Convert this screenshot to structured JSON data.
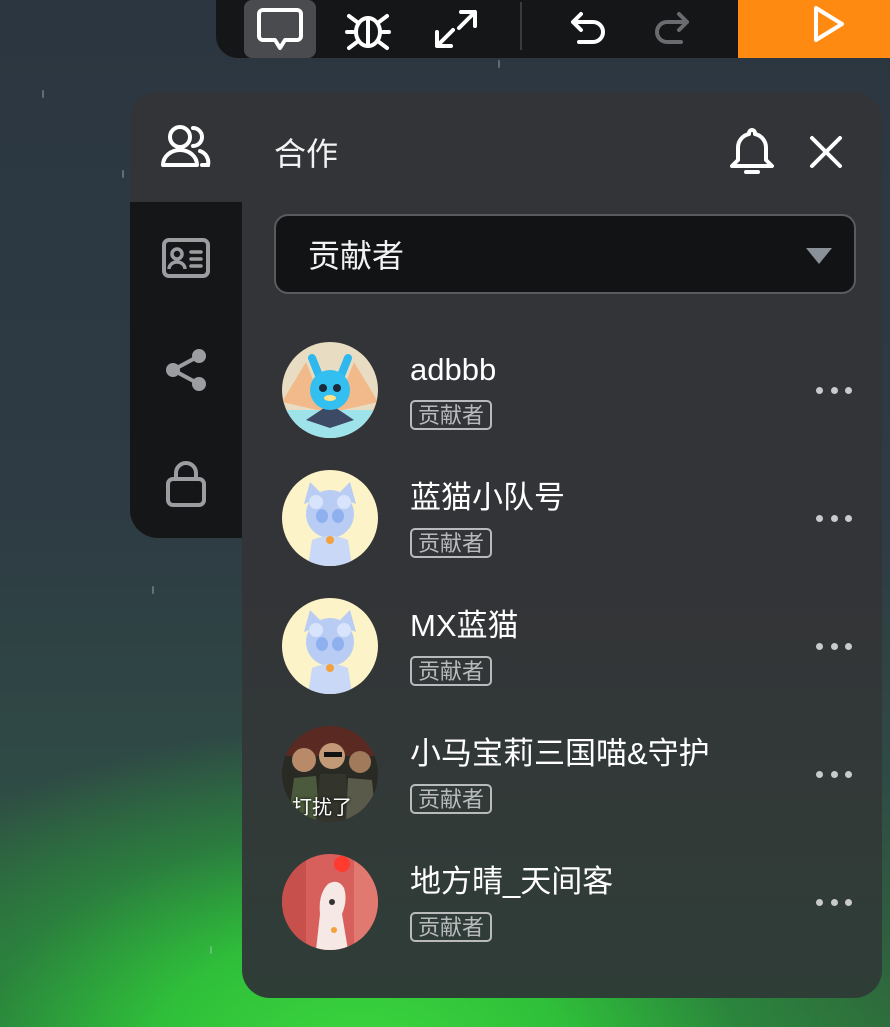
{
  "toolbar": {
    "icons": [
      "comment-icon",
      "bug-icon",
      "expand-icon",
      "undo-icon",
      "redo-icon",
      "play-icon"
    ],
    "run_color": "#ff8a12"
  },
  "panel": {
    "title": "合作",
    "rail_icons": [
      "users-icon",
      "id-card-icon",
      "share-icon",
      "lock-icon"
    ]
  },
  "role_select": {
    "value": "贡献者"
  },
  "members": [
    {
      "name": "adbbb",
      "role": "贡献者",
      "avatar": "blue-creature-avatar"
    },
    {
      "name": "蓝猫小队号",
      "role": "贡献者",
      "avatar": "blue-cat-avatar"
    },
    {
      "name": "MX蓝猫",
      "role": "贡献者",
      "avatar": "blue-cat-avatar"
    },
    {
      "name": "小马宝莉三国喵&守护",
      "role": "贡献者",
      "avatar": "photo-avatar",
      "avatar_caption": "打扰了"
    },
    {
      "name": "地方晴_天间客",
      "role": "贡献者",
      "avatar": "pink-figure-avatar"
    }
  ]
}
